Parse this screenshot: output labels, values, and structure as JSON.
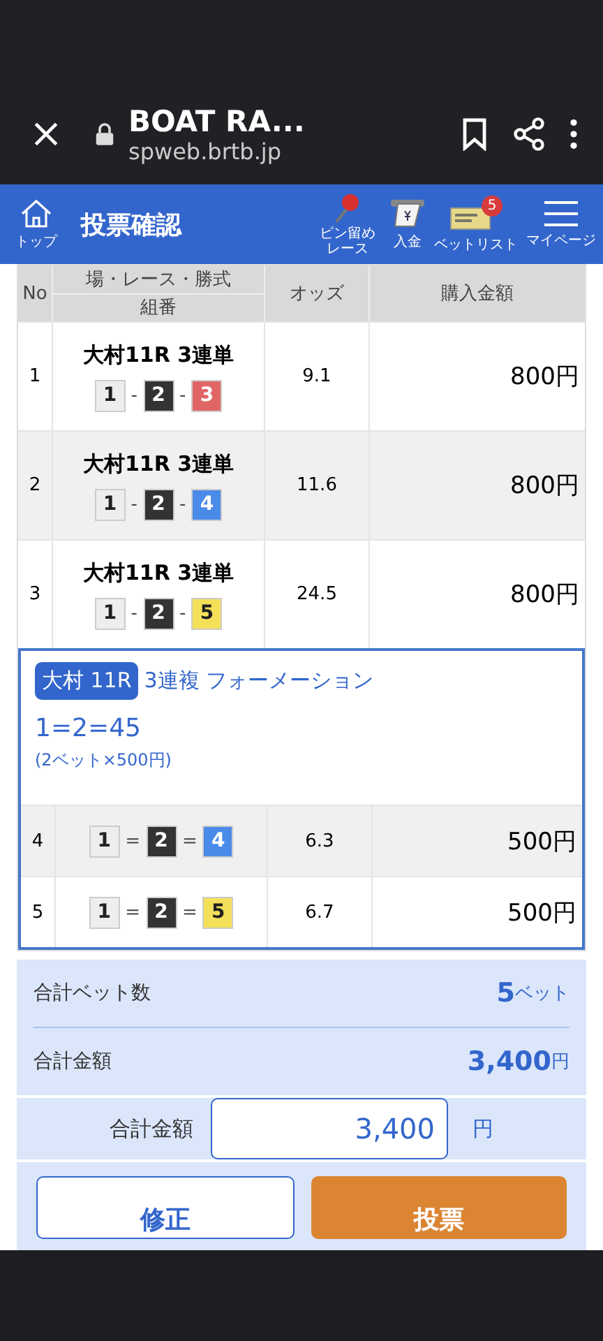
{
  "browser_bar": {
    "title": "BOAT RA...",
    "url": "spweb.brtb.jp"
  },
  "nav": {
    "home_label": "トップ",
    "title": "投票確認",
    "items": [
      {
        "kind": "pin",
        "label": "ピン留めレース"
      },
      {
        "kind": "deposit",
        "label": "入金"
      },
      {
        "kind": "betlist",
        "label": "ベットリスト",
        "badge": "5"
      },
      {
        "kind": "menu",
        "label": "マイページ"
      }
    ]
  },
  "table": {
    "columns": {
      "no": "No",
      "race": "場・レース・勝式",
      "combo": "組番",
      "odds": "オッズ",
      "amount": "購入金額"
    },
    "rows": [
      {
        "no": "1",
        "race": "大村11R 3連単",
        "sep": "-",
        "boxes": [
          {
            "n": "1",
            "color": "#eeeeee"
          },
          {
            "n": "2",
            "color": "#333333"
          },
          {
            "n": "3",
            "color": "#e06666"
          }
        ],
        "odds": "9.1",
        "amount": "800円"
      },
      {
        "no": "2",
        "race": "大村11R 3連単",
        "sep": "-",
        "boxes": [
          {
            "n": "1",
            "color": "#eeeeee"
          },
          {
            "n": "2",
            "color": "#333333"
          },
          {
            "n": "4",
            "color": "#4a8ae8"
          }
        ],
        "odds": "11.6",
        "amount": "800円"
      },
      {
        "no": "3",
        "race": "大村11R 3連単",
        "sep": "-",
        "boxes": [
          {
            "n": "1",
            "color": "#eeeeee"
          },
          {
            "n": "2",
            "color": "#333333"
          },
          {
            "n": "5",
            "color": "#f5e05a"
          }
        ],
        "odds": "24.5",
        "amount": "800円"
      }
    ],
    "formation": {
      "race_tag": "大村 11R",
      "type": "3連複 フォーメーション",
      "combo": "1=2=45",
      "detail": "(2ベット×500円)",
      "rows": [
        {
          "no": "4",
          "sep": "=",
          "boxes": [
            {
              "n": "1",
              "color": "#eeeeee"
            },
            {
              "n": "2",
              "color": "#333333"
            },
            {
              "n": "4",
              "color": "#4a8ae8"
            }
          ],
          "odds": "6.3",
          "amount": "500円"
        },
        {
          "no": "5",
          "sep": "=",
          "boxes": [
            {
              "n": "1",
              "color": "#eeeeee"
            },
            {
              "n": "2",
              "color": "#333333"
            },
            {
              "n": "5",
              "color": "#f5e05a"
            }
          ],
          "odds": "6.7",
          "amount": "500円"
        }
      ]
    }
  },
  "summary": {
    "bets_label": "合計ベット数",
    "bets_value": "5",
    "bets_unit": "ベット",
    "total_label": "合計金額",
    "total_value": "3,400",
    "total_unit": "円"
  },
  "input": {
    "label": "合計金額",
    "value": "3,400",
    "unit": "円"
  },
  "buttons": [
    {
      "kind": "secondary",
      "label": "修正"
    },
    {
      "kind": "primary",
      "label": "投票"
    }
  ]
}
